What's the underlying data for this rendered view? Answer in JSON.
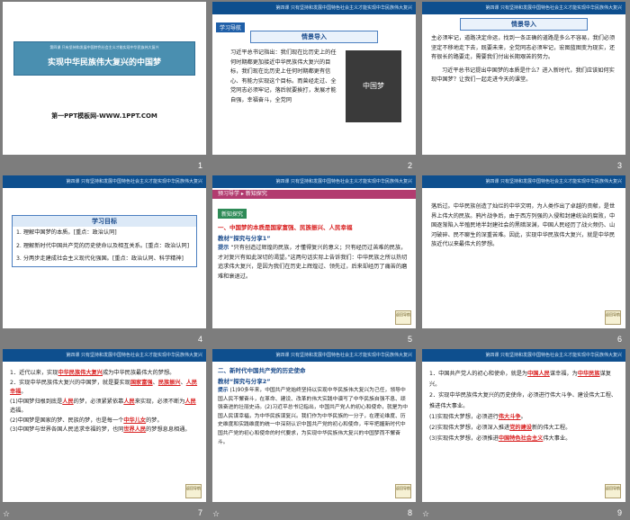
{
  "slides": [
    {
      "num": "1",
      "title": "实现中华民族伟大复兴的中国梦",
      "banner": "第四课  只有坚持和发展中国特色社会主义才能实现中华民族伟大复兴",
      "site": "第一PPT模板网-WWW.1PPT.COM"
    },
    {
      "num": "2",
      "header": "第四课  只有坚持和发展中国特色社会主义才能实现中华民族伟大复兴",
      "tag": "学习导航",
      "box": "情景导入",
      "text": "习近平总书记指出：我们现在比历史上的任何时期都更加接近中华民族伟大复兴的目标，我们现在比历史上任何时期都更有信心、有能力实现这个目标。而曾经走过、全党同志必须牢记，落后就要挨打，发展才能自强，幸福奋斗，全党同",
      "book_title": "中国梦"
    },
    {
      "num": "3",
      "header": "第四课  只有坚持和发展中国特色社会主义才能实现中华民族伟大复兴",
      "box": "情景导入",
      "text": "主必须牢记，道路决定命运，找到一条正确的道路是多么不容易，我们必须坚定不移地走下去，既要未来，全党同志必须牢记，宏图蓝图变为现实，还有很长的路要走，需要我们付出长期艰苦的努力。",
      "question": "习近平总书记提出中国梦的本质是什么？进入新时代，我们应该如何实现中国梦？让我们一起走进今天的课堂。"
    },
    {
      "num": "4",
      "header": "第四课  只有坚持和发展中国特色社会主义才能实现中华民族伟大复兴",
      "box": "学习目标",
      "items": [
        "1. 理解中国梦的本质。[重点：政治认同]",
        "2. 理解新时代中国共产党的历史使命以及相互关系。[重点：政治认同]",
        "3. 分两步走建成社会主义现代化强国。[重点：政治认同、科学精神]"
      ]
    },
    {
      "num": "5",
      "header": "第四课  只有坚持和发展中国特色社会主义才能实现中华民族伟大复兴",
      "nav": [
        "预习导学",
        "新知探究"
      ],
      "tag": "新知探究",
      "heading": "一、中国梦的本质是国家富强、民族振兴、人民幸福",
      "sub": "教材“探究与分享1”",
      "tip_label": "提示",
      "text": "“只有创造过辉煌的民族，才懂得复兴的意义；只有经历过苦难的民族，才对复兴有如此深切的渴望。”这两句话实际上告诉我们：中华民族之所以热切追求伟大复兴，是因为我们在历史上辉煌过、领先过，后来却经历了痛苦的磨难和衰退过。"
    },
    {
      "num": "6",
      "header": "第四课  只有坚持和发展中国特色社会主义才能实现中华民族伟大复兴",
      "text": "落后过。中华民族创造了灿烂的中华文明，为人类作出了卓越的贡献，是世界上伟大的民族。鸦片战争后，由于西方列强的入侵和封建统治的腐败，中国逐渐陷入半殖民地半封建社会的黑暗深渊，中国人民经历了战火频仍、山河破碎、民不聊生的深重苦难。因此，实现中华民族伟大复兴，就是中华民族近代以来最伟大的梦想。"
    },
    {
      "num": "7",
      "header": "第四课  只有坚持和发展中国特色社会主义才能实现中华民族伟大复兴",
      "lines": [
        "1．近代以来，实现",
        "中华民族伟大复兴",
        "成为中华民族最伟大的梦想。",
        "2．实现中华民族伟大复兴的中国梦，就是要实现",
        "国家富强",
        "民族振兴",
        "人民幸福",
        "(1)中国梦归根到底是",
        "人民",
        "的梦，必须紧紧依靠",
        "人民",
        "来实现，必须不断为",
        "人民",
        "造福。",
        "(2)中国梦是国家的梦、民族的梦，也是每一个",
        "中华儿女",
        "的梦。",
        "(3)中国梦与世界各国人民追求幸福的梦，也同",
        "世界人民",
        "的梦想息息相通。"
      ]
    },
    {
      "num": "8",
      "header": "第四课  只有坚持和发展中国特色社会主义才能实现中华民族伟大复兴",
      "heading": "二、新时代中国共产党的历史使命",
      "sub": "教材“探究与分享2”",
      "tip_label": "提示",
      "text": "(1)90多年来，中国共产党始终坚持以实现中华民族伟大复兴为己任，领导中国人民不懈奋斗，在革命、建设、改革的伟大实践中谱写了中华民族自强不息、顽强奋进的壮丽史诗。(2)习近平总书记指出，中国共产党人的初心和使命，就是为中国人民谋幸福，为中华民族谋复兴。我们作为中华民族的一分子，在理论维度、历史维度和实践维度的统一中深刻认识中国共产党的初心和使命，牢牢把握新时代中国共产党的初心和使命的时代要求，为实现中华民族伟大复兴的中国梦而不懈奋斗。"
    },
    {
      "num": "9",
      "header": "第四课  只有坚持和发展中国特色社会主义才能实现中华民族伟大复兴",
      "lines": [
        "1．中国共产党人的初心和使命，就是为",
        "中国人民",
        "谋幸福，为",
        "中华民族",
        "谋复兴。",
        "2．实现中华民族伟大复兴的历史使命，必须进行伟大斗争、建设伟大工程、推进伟大事业。",
        "(1)实现伟大梦想，必须进行",
        "伟大斗争",
        "。",
        "(2)实现伟大梦想，必须深入推进",
        "党的建设",
        "新的伟大工程。",
        "(3)实现伟大梦想，必须推进",
        "中国特色社会主义",
        "伟大事业。"
      ]
    }
  ],
  "colors": {
    "accent": "#0e4f8e",
    "answer": "#d92020",
    "bg": "#7d7d7d"
  },
  "icons": {
    "star": "star-icon",
    "mark": "return-mark-icon"
  },
  "star_glyph": "☆",
  "mark_text": "返回导航"
}
